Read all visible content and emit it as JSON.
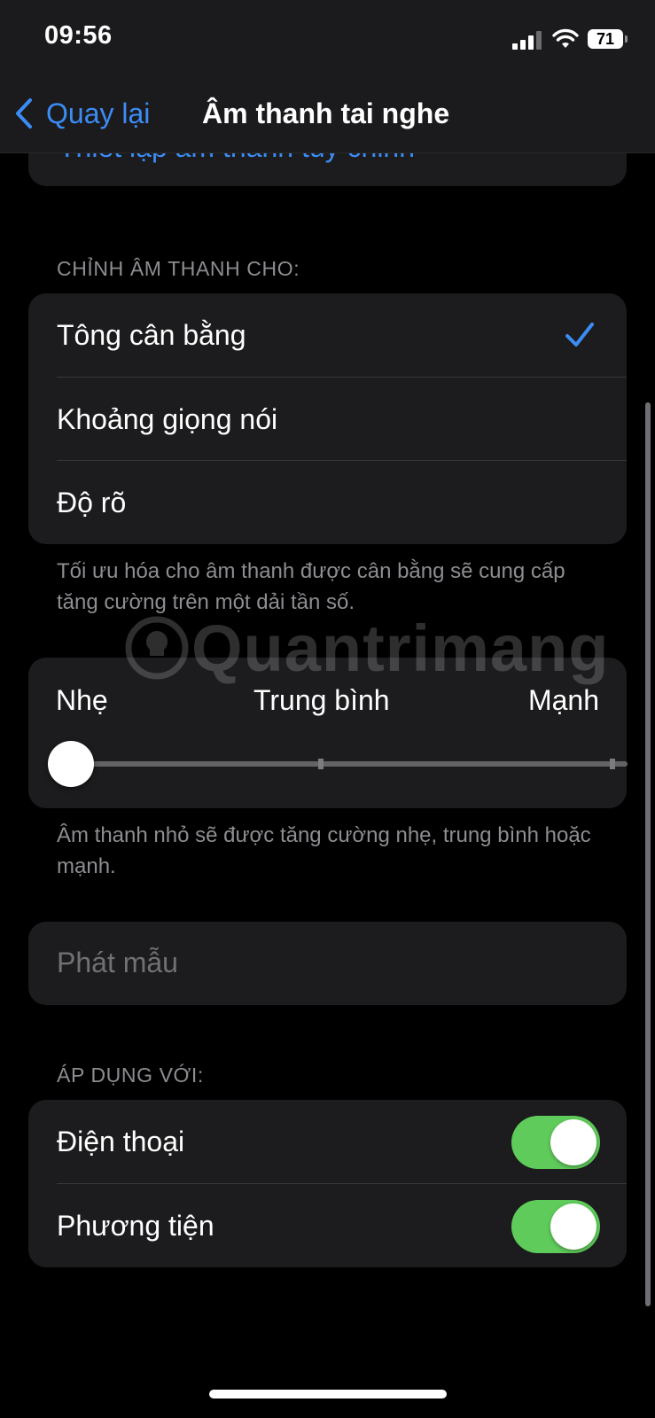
{
  "status_bar": {
    "time": "09:56",
    "battery": "71",
    "icons": [
      "cellular-signal-icon",
      "wifi-icon",
      "battery-icon"
    ]
  },
  "nav": {
    "back_label": "Quay lại",
    "title": "Âm thanh tai nghe",
    "accent_color": "#3b8cf5"
  },
  "top_card": {
    "partial_link": "Thiết lập âm thanh tùy chỉnh"
  },
  "tune_section": {
    "header": "CHỈNH ÂM THANH CHO:",
    "options": [
      {
        "label": "Tông cân bằng",
        "selected": true
      },
      {
        "label": "Khoảng giọng nói",
        "selected": false
      },
      {
        "label": "Độ rõ",
        "selected": false
      }
    ],
    "footnote": "Tối ưu hóa cho âm thanh được cân bằng sẽ cung cấp tăng cường trên một dải tần số."
  },
  "strength": {
    "labels": [
      "Nhẹ",
      "Trung bình",
      "Mạnh"
    ],
    "value_index": 0,
    "footnote": "Âm thanh nhỏ sẽ được tăng cường nhẹ, trung bình hoặc mạnh."
  },
  "sample": {
    "label": "Phát mẫu"
  },
  "apply_section": {
    "header": "ÁP DỤNG VỚI:",
    "items": [
      {
        "label": "Điện thoại",
        "on": true
      },
      {
        "label": "Phương tiện",
        "on": true
      }
    ],
    "toggle_color": "#5fcb5a"
  },
  "watermark": "Quantrimang"
}
